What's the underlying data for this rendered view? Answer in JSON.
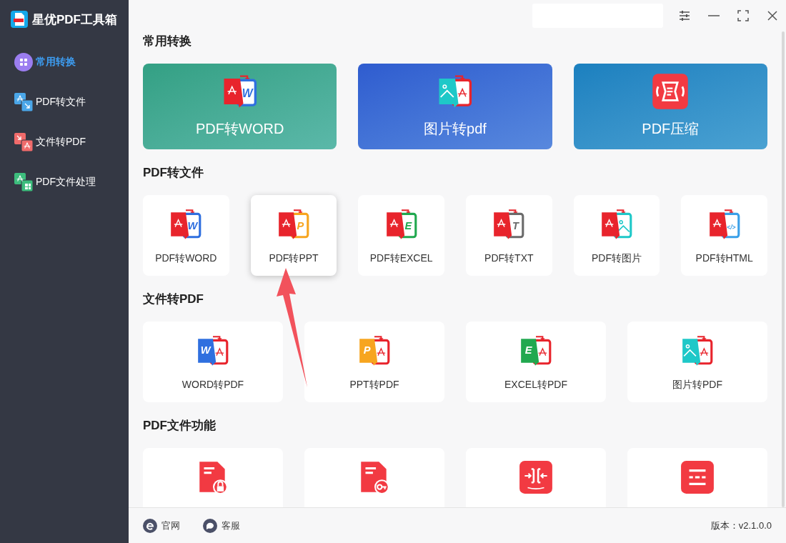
{
  "app": {
    "title": "星优PDF工具箱"
  },
  "window_controls": [
    {
      "kind": "settings"
    },
    {
      "kind": "minimize"
    },
    {
      "kind": "maximize"
    },
    {
      "kind": "close"
    }
  ],
  "sidebar": {
    "items": [
      {
        "label": "常用转换",
        "kind": "grid",
        "selected": true
      },
      {
        "label": "PDF转文件",
        "kind": "out",
        "selected": false
      },
      {
        "label": "文件转PDF",
        "kind": "in",
        "selected": false
      },
      {
        "label": "PDF文件处理",
        "kind": "tools",
        "selected": false
      }
    ]
  },
  "sections": [
    {
      "title": "常用转换",
      "kind": "cards",
      "items": [
        {
          "label": "PDF转WORD",
          "color": "#33a084",
          "kind": "pdf-to-word",
          "letter": "W"
        },
        {
          "label": "图片转pdf",
          "color": "#2f5ccf",
          "kind": "image-to-pdf"
        },
        {
          "label": "PDF压缩",
          "color": "#1b80bf",
          "kind": "compress"
        }
      ]
    },
    {
      "title": "PDF转文件",
      "kind": "tiles",
      "items": [
        {
          "label": "PDF转WORD",
          "hovered": false,
          "kind": "pdf-to-word",
          "letter": "W"
        },
        {
          "label": "PDF转PPT",
          "hovered": true,
          "kind": "pdf-to-ppt",
          "letter": "P"
        },
        {
          "label": "PDF转EXCEL",
          "hovered": false,
          "kind": "pdf-to-excel",
          "letter": "E"
        },
        {
          "label": "PDF转TXT",
          "hovered": false,
          "kind": "pdf-to-txt",
          "letter": "T"
        },
        {
          "label": "PDF转图片",
          "hovered": false,
          "kind": "pdf-to-image"
        },
        {
          "label": "PDF转HTML",
          "hovered": false,
          "kind": "pdf-to-html",
          "letter": "</>"
        }
      ]
    },
    {
      "title": "文件转PDF",
      "kind": "tiles",
      "items": [
        {
          "label": "WORD转PDF",
          "hovered": false,
          "kind": "word-to-pdf",
          "letter": "W"
        },
        {
          "label": "PPT转PDF",
          "hovered": false,
          "kind": "ppt-to-pdf",
          "letter": "P"
        },
        {
          "label": "EXCEL转PDF",
          "hovered": false,
          "kind": "excel-to-pdf",
          "letter": "E"
        },
        {
          "label": "图片转PDF",
          "hovered": false,
          "kind": "image-to-pdf"
        }
      ]
    },
    {
      "title": "PDF文件功能",
      "kind": "tiles",
      "items": [
        {
          "hovered": false,
          "kind": "lock"
        },
        {
          "hovered": false,
          "kind": "key"
        },
        {
          "hovered": false,
          "kind": "merge"
        },
        {
          "hovered": false,
          "kind": "list"
        }
      ]
    }
  ],
  "footer": {
    "links": [
      {
        "label": "官网",
        "kind": "browser"
      },
      {
        "label": "客服",
        "kind": "chat"
      }
    ],
    "version": "版本：v2.1.0.0"
  }
}
